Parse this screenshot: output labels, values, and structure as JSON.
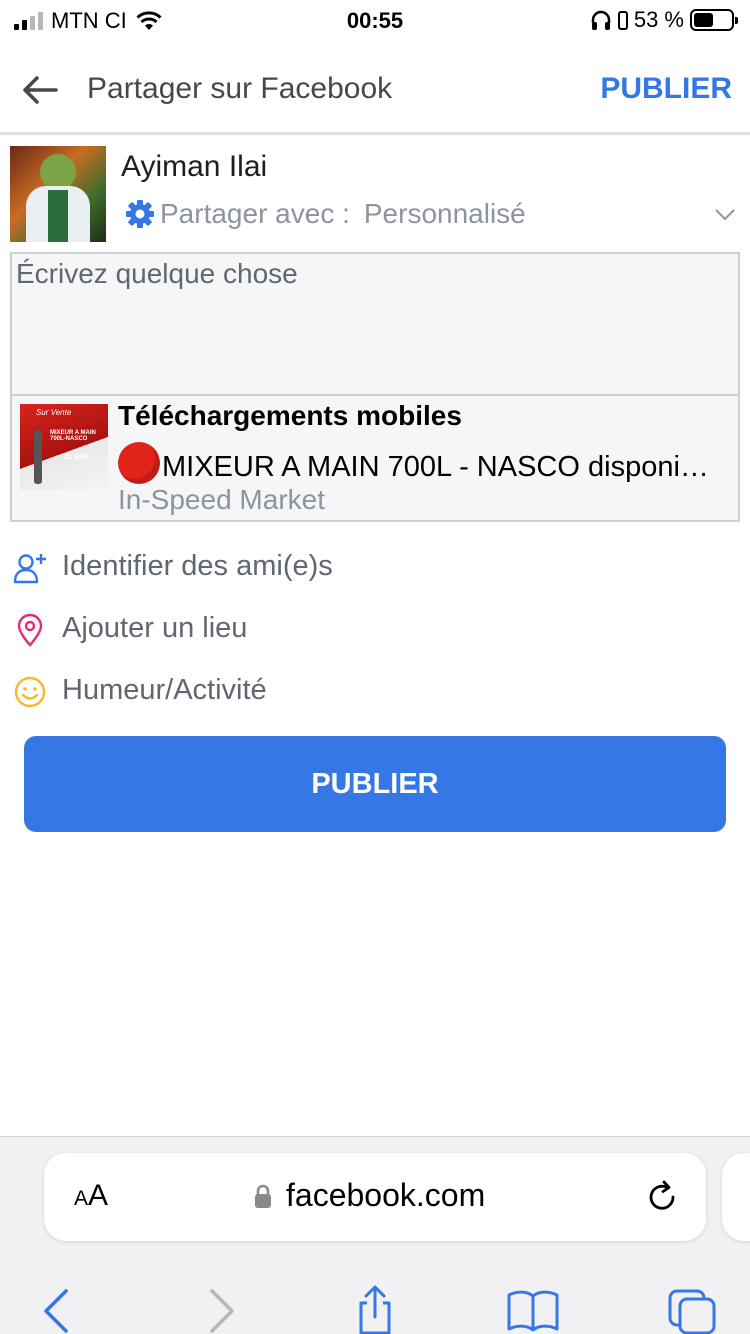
{
  "status_bar": {
    "carrier": "MTN CI",
    "time": "00:55",
    "battery_percent": "53 %",
    "battery_level": 0.53
  },
  "header": {
    "title": "Partager sur Facebook",
    "publish_label": "PUBLIER"
  },
  "composer": {
    "user_name": "Ayiman Ilai",
    "privacy_label": "Partager avec :",
    "privacy_value": "Personnalisé",
    "placeholder": "Écrivez quelque chose"
  },
  "link_preview": {
    "title": "Téléchargements mobiles",
    "description": "MIXEUR A MAIN 700L - NASCO disponi…",
    "source": "In-Speed Market",
    "thumbnail": {
      "tag": "Sur Vente",
      "line1": "MIXEUR A MAIN 700L-NASCO",
      "price": "23 500F"
    }
  },
  "options": [
    {
      "label": "Identifier des ami(e)s",
      "icon": "tag-friends-icon",
      "color": "#3578e5"
    },
    {
      "label": "Ajouter un lieu",
      "icon": "location-pin-icon",
      "color": "#e42d6b"
    },
    {
      "label": "Humeur/Activité",
      "icon": "smiley-icon",
      "color": "#f7b928"
    }
  ],
  "publish_button": {
    "label": "PUBLIER"
  },
  "browser": {
    "text_size_label": "AA",
    "url": "facebook.com"
  },
  "colors": {
    "accent": "#3578e5",
    "muted_text": "#606770",
    "placeholder_grey": "#8d949e"
  }
}
